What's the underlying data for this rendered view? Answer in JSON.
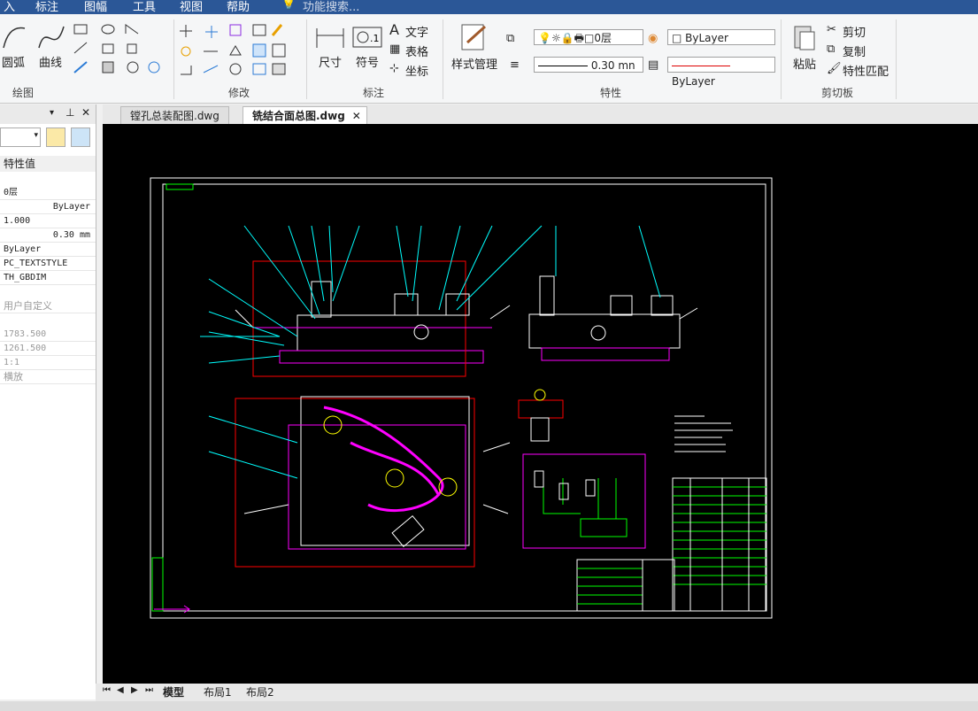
{
  "menu": [
    "入",
    "标注",
    "图幅",
    "工具",
    "视图",
    "帮助",
    "功能搜索..."
  ],
  "ribbon": {
    "draw": {
      "arc": "圆弧",
      "curve": "曲线",
      "group": "绘图"
    },
    "modify": {
      "group": "修改"
    },
    "annotate": {
      "dimension": "尺寸",
      "symbol": "符号",
      "text": "文字",
      "table": "表格",
      "coordinate": "坐标",
      "group": "标注"
    },
    "properties": {
      "style_manager": "样式管理",
      "layer": "0层",
      "color": "ByLayer",
      "linewidth": "0.30 mn",
      "linetype": "ByLayer",
      "group": "特性"
    },
    "clipboard": {
      "paste": "粘贴",
      "cut": "剪切",
      "copy": "复制",
      "match": "特性匹配",
      "group": "剪切板"
    }
  },
  "props_panel": {
    "header": "特性值",
    "rows": [
      "0层",
      "ByLayer",
      "1.000",
      "0.30 mm",
      "ByLayer",
      "PC_TEXTSTYLE",
      "TH_GBDIM",
      "用户自定义",
      "1783.500",
      "1261.500",
      "1:1",
      "横放"
    ]
  },
  "doc_tabs": [
    "镗孔总装配图.dwg",
    "铣结合面总图.dwg"
  ],
  "layout_tabs": [
    "模型",
    "布局1",
    "布局2"
  ],
  "colors": {
    "accent": "#2b5797",
    "canvas": "#000000",
    "cyan": "#00ffff",
    "magenta": "#ff00ff",
    "green": "#00ff00",
    "red": "#ff0000"
  }
}
